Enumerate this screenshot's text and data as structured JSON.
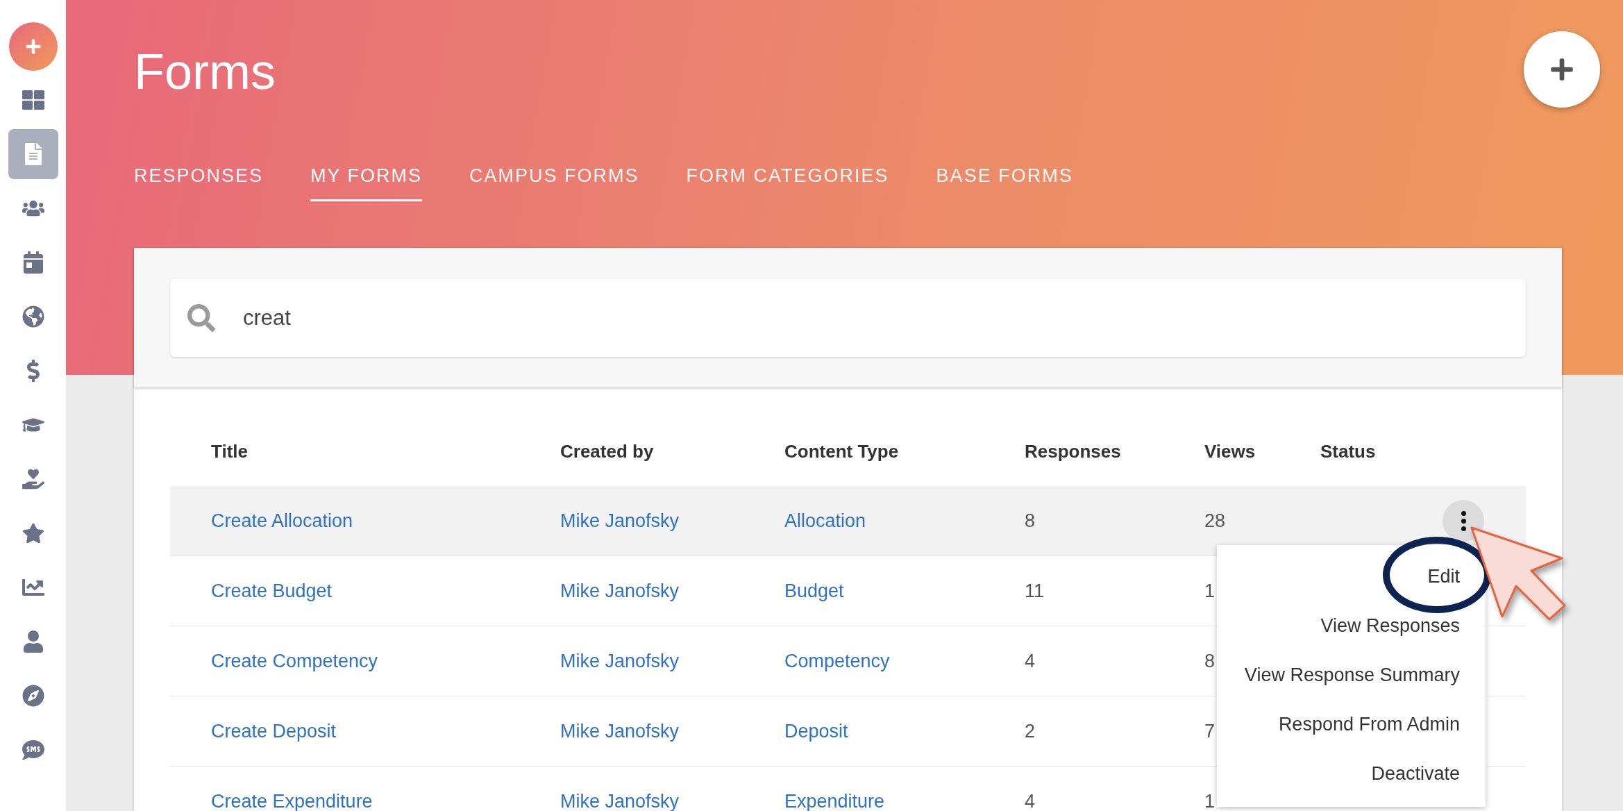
{
  "sidebar": {
    "items": [
      {
        "kind": "add",
        "selected": false
      },
      {
        "kind": "dashboard",
        "selected": false
      },
      {
        "kind": "forms",
        "selected": true
      },
      {
        "kind": "groups",
        "selected": false
      },
      {
        "kind": "calendar",
        "selected": false
      },
      {
        "kind": "globe",
        "selected": false
      },
      {
        "kind": "finance",
        "selected": false
      },
      {
        "kind": "education",
        "selected": false
      },
      {
        "kind": "service",
        "selected": false
      },
      {
        "kind": "star",
        "selected": false
      },
      {
        "kind": "chart",
        "selected": false
      },
      {
        "kind": "person",
        "selected": false
      },
      {
        "kind": "compass",
        "selected": false
      },
      {
        "kind": "sms",
        "selected": false
      }
    ]
  },
  "page": {
    "title": "Forms"
  },
  "tabs": [
    {
      "label": "RESPONSES",
      "selected": false
    },
    {
      "label": "MY FORMS",
      "selected": true
    },
    {
      "label": "CAMPUS FORMS",
      "selected": false
    },
    {
      "label": "FORM CATEGORIES",
      "selected": false
    },
    {
      "label": "BASE FORMS",
      "selected": false
    }
  ],
  "search": {
    "value": "creat"
  },
  "table": {
    "columns": [
      "Title",
      "Created by",
      "Content Type",
      "Responses",
      "Views",
      "Status"
    ],
    "rows": [
      {
        "title": "Create Allocation",
        "created_by": "Mike Janofsky",
        "content_type": "Allocation",
        "responses": "8",
        "views": "28",
        "highlighted": true
      },
      {
        "title": "Create Budget",
        "created_by": "Mike Janofsky",
        "content_type": "Budget",
        "responses": "11",
        "views": "1",
        "highlighted": false
      },
      {
        "title": "Create Competency",
        "created_by": "Mike Janofsky",
        "content_type": "Competency",
        "responses": "4",
        "views": "8",
        "highlighted": false
      },
      {
        "title": "Create Deposit",
        "created_by": "Mike Janofsky",
        "content_type": "Deposit",
        "responses": "2",
        "views": "7",
        "highlighted": false
      },
      {
        "title": "Create Expenditure",
        "created_by": "Mike Janofsky",
        "content_type": "Expenditure",
        "responses": "4",
        "views": "1",
        "highlighted": false
      }
    ]
  },
  "menu": {
    "items": [
      {
        "label": "Edit",
        "circled": true
      },
      {
        "label": "View Responses",
        "circled": false
      },
      {
        "label": "View Response Summary",
        "circled": false
      },
      {
        "label": "Respond From Admin",
        "circled": false
      },
      {
        "label": "Deactivate",
        "circled": false
      }
    ]
  },
  "annotation": {
    "pointer": true
  }
}
